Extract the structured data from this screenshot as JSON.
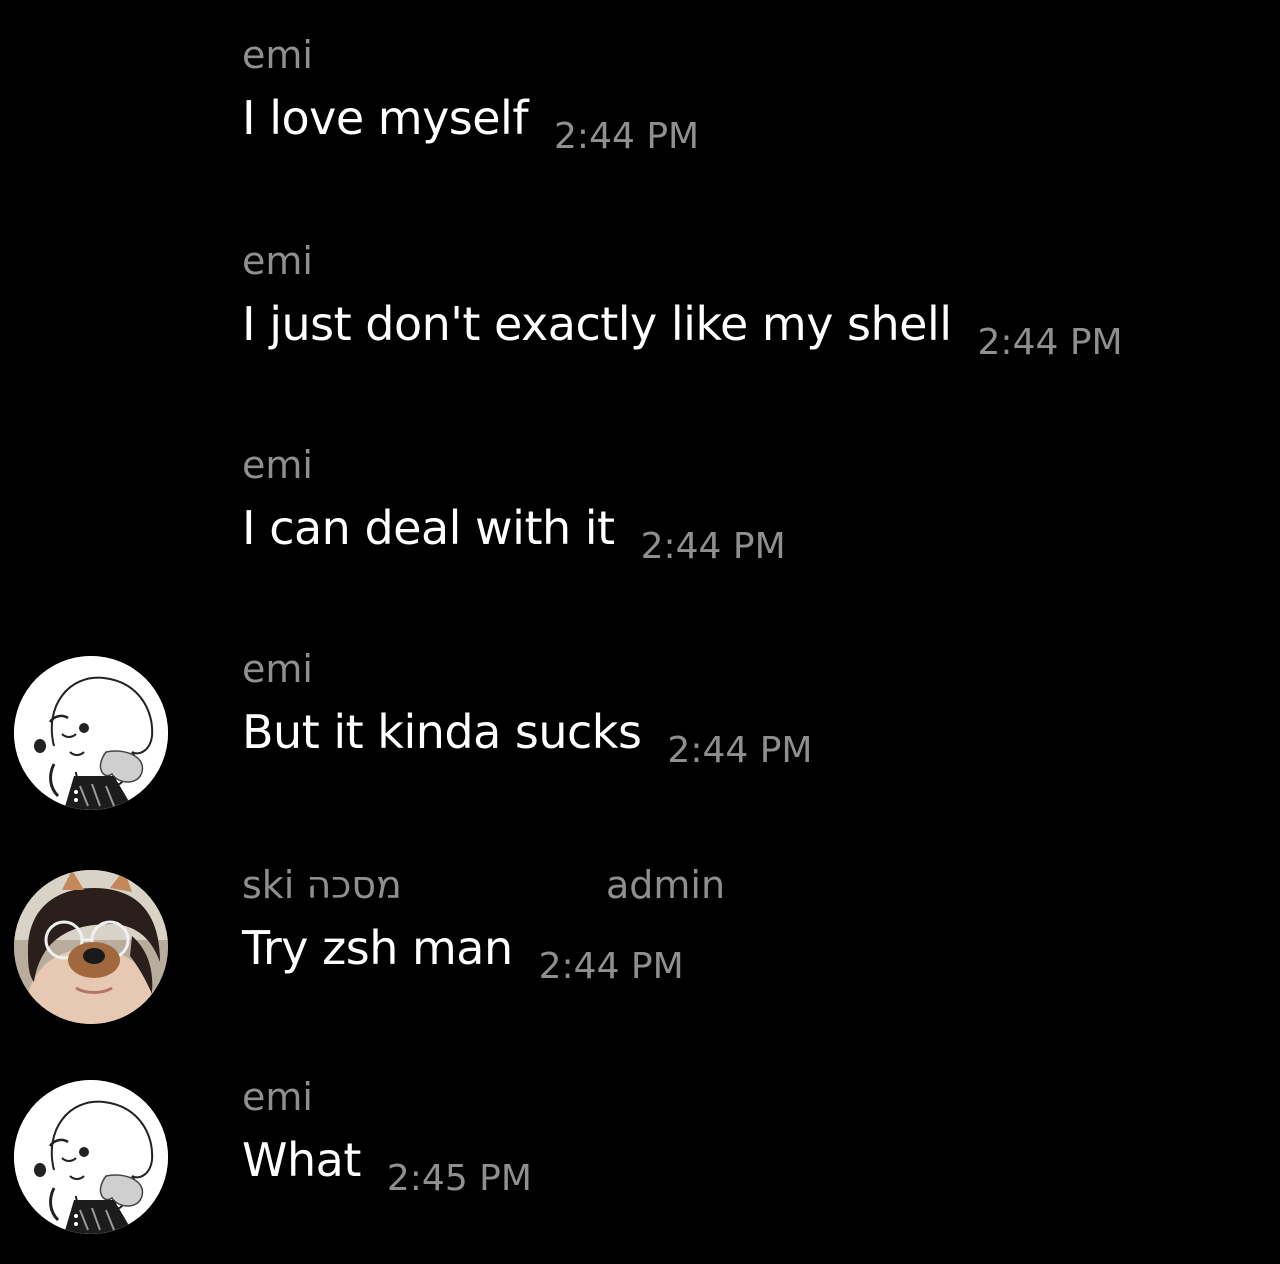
{
  "messages": [
    {
      "sender": "emi",
      "text": "I love myself",
      "time": "2:44 PM"
    },
    {
      "sender": "emi",
      "text": "I just don't exactly like my shell",
      "time": "2:44 PM"
    },
    {
      "sender": "emi",
      "text": "I can deal with it",
      "time": "2:44 PM"
    },
    {
      "sender": "emi",
      "text": "But it kinda sucks",
      "time": "2:44 PM"
    },
    {
      "sender": "ski מסכה",
      "role": "admin",
      "text": "Try zsh man",
      "time": "2:44 PM"
    },
    {
      "sender": "emi",
      "text": "What",
      "time": "2:45 PM"
    }
  ],
  "avatars": {
    "emi": "avatar-emi-drawing",
    "ski": "avatar-ski-photo"
  },
  "colors": {
    "background": "#000000",
    "sender": "#8f8f8f",
    "text": "#ffffff",
    "time": "#8f8f8f"
  }
}
